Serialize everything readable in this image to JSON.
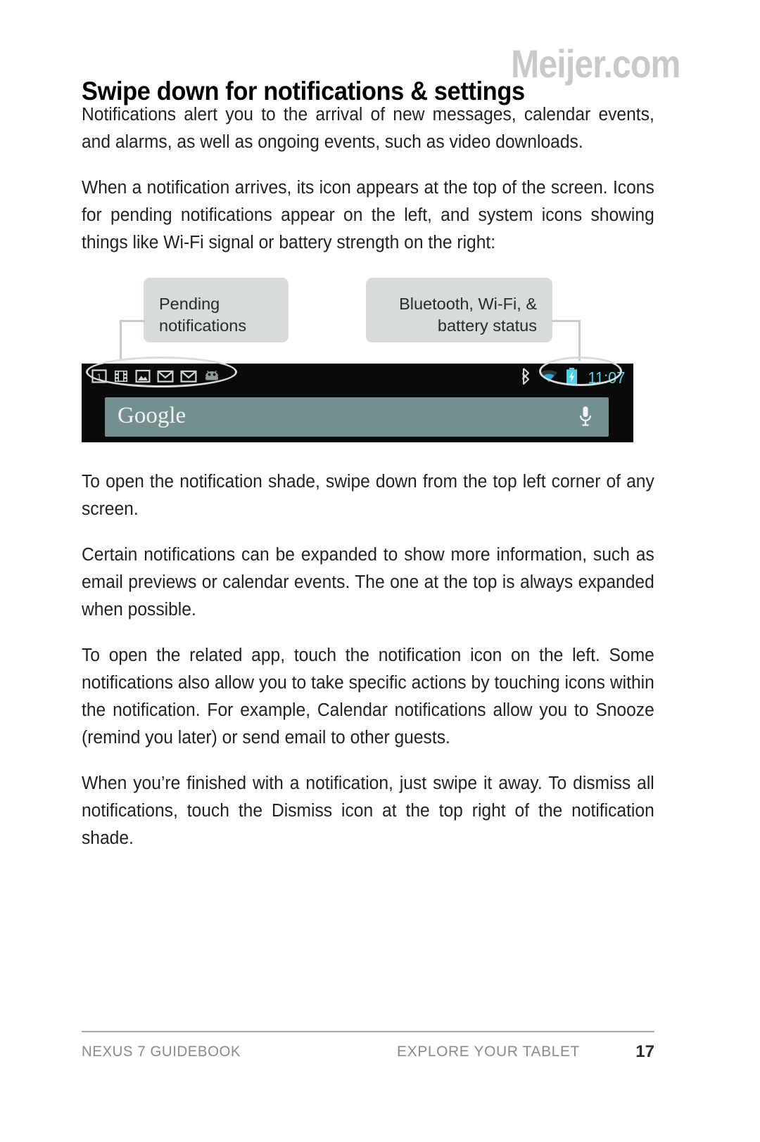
{
  "page": {
    "title": "Swipe down for notifications & settings",
    "watermark": "Meijer.com"
  },
  "paragraphs": [
    "Notifications alert you to the arrival of new messages, calendar events, and alarms, as well as ongoing events, such as video downloads.",
    "When a notification arrives, its icon appears at the top of the screen. Icons for pending notifications appear on the left, and system icons showing things like Wi-Fi signal or battery strength on the right:",
    "To open the notification shade, swipe down from the top left corner of any screen.",
    "Certain notifications can be expanded to show more information, such as email previews or calendar events. The one at the top is always expanded when possible.",
    "To open the related app, touch the notification icon on the left. Some notifications also allow you to take specific actions by touching icons within the notification. For example, Calendar notifications allow you to Snooze (remind you later) or send email to other guests.",
    "When you’re finished with a notification, just swipe it away. To dismiss all notifications, touch the Dismiss icon at the top right of the notification shade."
  ],
  "figure": {
    "callout_left": "Pending notifications",
    "callout_right": "Bluetooth, Wi-Fi, & battery status",
    "statusbar": {
      "clock": "11:07",
      "notification_icons": [
        "calendar-icon",
        "film-strip-icon",
        "photo-icon",
        "gmail-icon",
        "gmail-icon",
        "android-robot-icon"
      ],
      "system_icons": [
        "bluetooth-icon",
        "wifi-icon",
        "battery-charging-icon"
      ]
    },
    "search_bar": {
      "logo_text": "Google",
      "voice_icon": "microphone-icon"
    },
    "colors": {
      "callout_bg": "#d5dcda",
      "statusbar_bg": "#0a0a0a",
      "searchbar_bg": "#74908e",
      "accent_cyan": "#4fd0e7",
      "leader_line": "#c3ccca"
    }
  },
  "footer": {
    "left": "NEXUS 7 GUIDEBOOK",
    "center": "EXPLORE YOUR TABLET",
    "page_number": "17"
  }
}
